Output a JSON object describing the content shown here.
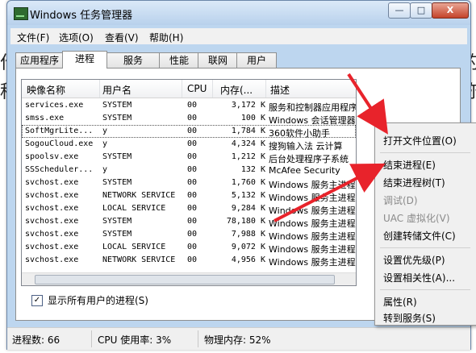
{
  "window": {
    "title": "Windows 任务管理器",
    "controls": {
      "minimize": "—",
      "maximize": "□",
      "close": "X"
    }
  },
  "menu": [
    "文件(F)",
    "选项(O)",
    "查看(V)",
    "帮助(H)"
  ],
  "tabs": [
    "应用程序",
    "进程",
    "服务",
    "性能",
    "联网",
    "用户"
  ],
  "active_tab": "进程",
  "columns": [
    "映像名称",
    "用户名",
    "CPU",
    "内存(...",
    "描述"
  ],
  "processes": [
    {
      "name": "services.exe",
      "user": "SYSTEM",
      "cpu": "00",
      "mem": "3,172 K",
      "desc": "服务和控制器应用程序"
    },
    {
      "name": "smss.exe",
      "user": "SYSTEM",
      "cpu": "00",
      "mem": "100 K",
      "desc": "Windows 会话管理器"
    },
    {
      "name": "SoftMgrLite...",
      "user": "y",
      "cpu": "00",
      "mem": "1,784 K",
      "desc": "360软件小助手"
    },
    {
      "name": "SogouCloud.exe",
      "user": "y",
      "cpu": "00",
      "mem": "4,324 K",
      "desc": "搜狗输入法 云计算"
    },
    {
      "name": "spoolsv.exe",
      "user": "SYSTEM",
      "cpu": "00",
      "mem": "1,212 K",
      "desc": "后台处理程序子系统"
    },
    {
      "name": "SSScheduler...",
      "user": "y",
      "cpu": "00",
      "mem": "132 K",
      "desc": "McAfee Security"
    },
    {
      "name": "svchost.exe",
      "user": "SYSTEM",
      "cpu": "00",
      "mem": "1,760 K",
      "desc": "Windows 服务主进程"
    },
    {
      "name": "svchost.exe",
      "user": "NETWORK SERVICE",
      "cpu": "00",
      "mem": "5,132 K",
      "desc": "Windows 服务主进程"
    },
    {
      "name": "svchost.exe",
      "user": "LOCAL SERVICE",
      "cpu": "00",
      "mem": "9,284 K",
      "desc": "Windows 服务主进程"
    },
    {
      "name": "svchost.exe",
      "user": "SYSTEM",
      "cpu": "00",
      "mem": "78,180 K",
      "desc": "Windows 服务主进程"
    },
    {
      "name": "svchost.exe",
      "user": "SYSTEM",
      "cpu": "00",
      "mem": "7,988 K",
      "desc": "Windows 服务主进程"
    },
    {
      "name": "svchost.exe",
      "user": "LOCAL SERVICE",
      "cpu": "00",
      "mem": "9,072 K",
      "desc": "Windows 服务主进程"
    },
    {
      "name": "svchost.exe",
      "user": "NETWORK SERVICE",
      "cpu": "00",
      "mem": "4,956 K",
      "desc": "Windows 服务主进程"
    }
  ],
  "selected_row": "SoftMgrLite...",
  "show_all_users": {
    "label": "显示所有用户的进程(S)",
    "checked": "✓"
  },
  "status": {
    "processes": "进程数: 66",
    "cpu": "CPU 使用率: 3%",
    "memory": "物理内存: 52%"
  },
  "context_menu": [
    {
      "label": "打开文件位置(O)",
      "enabled": true
    },
    {
      "label": "结束进程(E)",
      "enabled": true
    },
    {
      "label": "结束进程树(T)",
      "enabled": true
    },
    {
      "label": "调试(D)",
      "enabled": false
    },
    {
      "label": "UAC 虚拟化(V)",
      "enabled": false
    },
    {
      "label": "创建转储文件(C)",
      "enabled": true
    },
    {
      "label": "设置优先级(P)",
      "enabled": true
    },
    {
      "label": "设置相关性(A)...",
      "enabled": true
    },
    {
      "label": "属性(R)",
      "enabled": true
    },
    {
      "label": "转到服务(S)",
      "enabled": true
    }
  ],
  "colors": {
    "accent": "#bdd6ef",
    "arrow": "#e8232b",
    "selection_outline": "#555555"
  }
}
